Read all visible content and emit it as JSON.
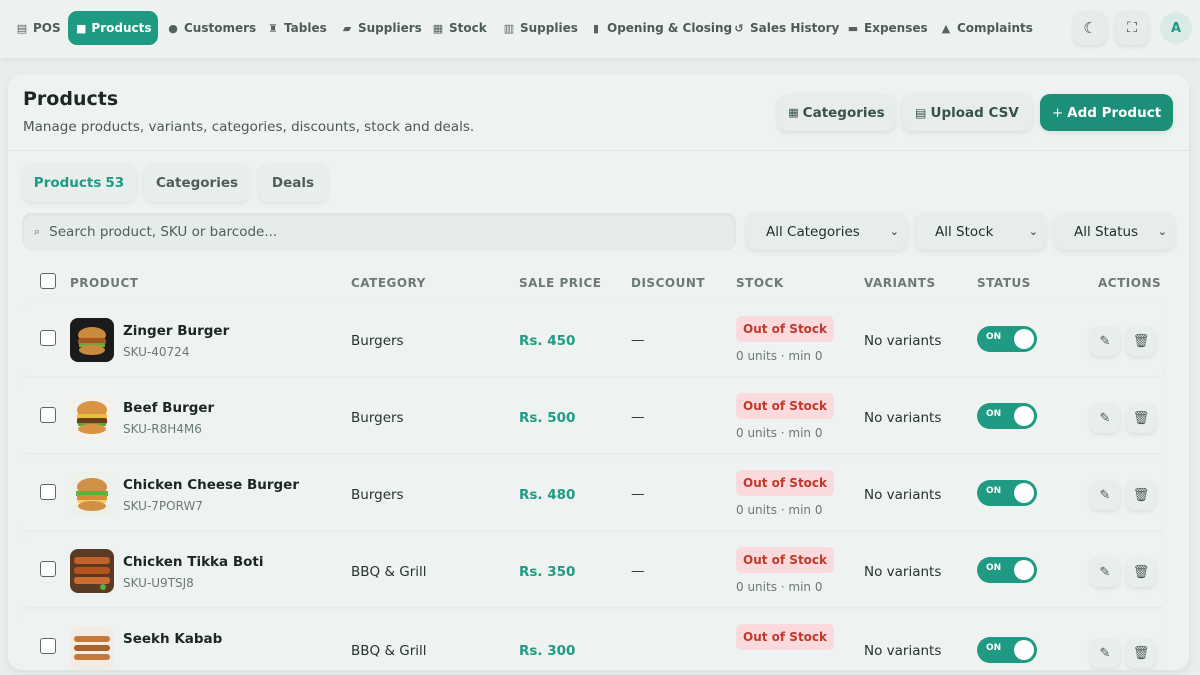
{
  "nav": {
    "items": [
      {
        "label": "POS",
        "icon": "cash-register-icon"
      },
      {
        "label": "Products",
        "icon": "box-icon",
        "active": true
      },
      {
        "label": "Customers",
        "icon": "users-icon"
      },
      {
        "label": "Tables",
        "icon": "chair-icon"
      },
      {
        "label": "Suppliers",
        "icon": "truck-icon"
      },
      {
        "label": "Stock",
        "icon": "warehouse-icon"
      },
      {
        "label": "Supplies",
        "icon": "dolly-icon"
      },
      {
        "label": "Opening & Closing",
        "icon": "book-icon"
      },
      {
        "label": "Sales History",
        "icon": "history-icon"
      },
      {
        "label": "Expenses",
        "icon": "wallet-icon"
      },
      {
        "label": "Complaints",
        "icon": "warning-icon"
      }
    ],
    "avatar": "A",
    "accent": "#1f9b84"
  },
  "header": {
    "title": "Products",
    "subtitle": "Manage products, variants, categories, discounts, stock and deals.",
    "buttons": {
      "categories": "Categories",
      "upload": "Upload CSV",
      "add": "Add Product",
      "add_prefix": "+"
    }
  },
  "tabs": [
    {
      "label": "Products",
      "count": "53",
      "active": true
    },
    {
      "label": "Categories"
    },
    {
      "label": "Deals"
    }
  ],
  "filters": {
    "search_placeholder": "Search product, SKU or barcode...",
    "category": "All Categories",
    "stock": "All Stock",
    "status": "All Status"
  },
  "table": {
    "columns": [
      "PRODUCT",
      "CATEGORY",
      "SALE PRICE",
      "DISCOUNT",
      "STOCK",
      "VARIANTS",
      "STATUS",
      "ACTIONS"
    ],
    "rows": [
      {
        "name": "Zinger Burger",
        "sku": "SKU-40724",
        "category": "Burgers",
        "price": "Rs. 450",
        "discount": "—",
        "stock_badge": "Out of Stock",
        "stock_units": "0 units · min 0",
        "variants": "No variants",
        "status": "ON"
      },
      {
        "name": "Beef Burger",
        "sku": "SKU-R8H4M6",
        "category": "Burgers",
        "price": "Rs. 500",
        "discount": "—",
        "stock_badge": "Out of Stock",
        "stock_units": "0 units · min 0",
        "variants": "No variants",
        "status": "ON"
      },
      {
        "name": "Chicken Cheese Burger",
        "sku": "SKU-7PORW7",
        "category": "Burgers",
        "price": "Rs. 480",
        "discount": "—",
        "stock_badge": "Out of Stock",
        "stock_units": "0 units · min 0",
        "variants": "No variants",
        "status": "ON"
      },
      {
        "name": "Chicken Tikka Boti",
        "sku": "SKU-U9TSJ8",
        "category": "BBQ & Grill",
        "price": "Rs. 350",
        "discount": "—",
        "stock_badge": "Out of Stock",
        "stock_units": "0 units · min 0",
        "variants": "No variants",
        "status": "ON"
      },
      {
        "name": "Seekh Kabab",
        "sku": "",
        "category": "BBQ & Grill",
        "price": "Rs. 300",
        "discount": "",
        "stock_badge": "Out of Stock",
        "stock_units": "",
        "variants": "No variants",
        "status": "ON"
      }
    ]
  }
}
